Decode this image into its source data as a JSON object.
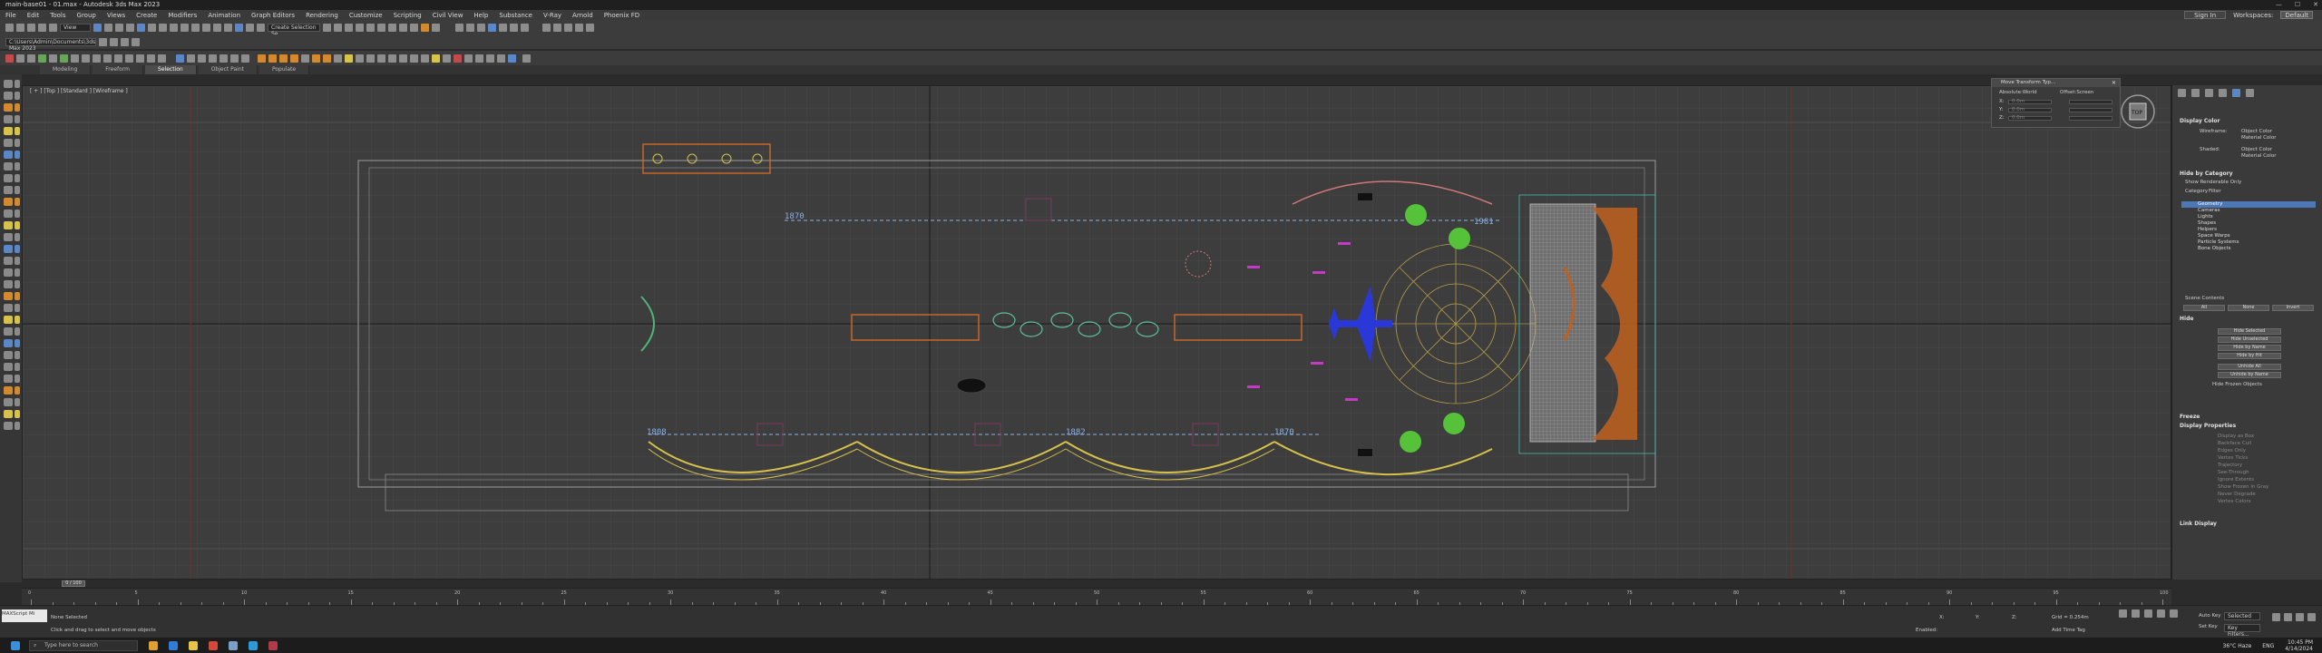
{
  "app": {
    "window_title": "main-base01 - 01.max - Autodesk 3ds Max 2023",
    "win_buttons": [
      "—",
      "☐",
      "✕"
    ]
  },
  "menu": {
    "items": [
      "File",
      "Edit",
      "Tools",
      "Group",
      "Views",
      "Create",
      "Modifiers",
      "Animation",
      "Graph Editors",
      "Rendering",
      "Customize",
      "Scripting",
      "Civil View",
      "Help",
      "Substance",
      "V-Ray",
      "Arnold",
      "Phoenix FD"
    ],
    "sign_in": "Sign In",
    "workspaces_label": "Workspaces:",
    "workspaces_value": "Default"
  },
  "toolbar": {
    "selection_filter": "View",
    "selection_set": "Create Selection Se"
  },
  "project_path": "C:\\Users\\Admin\\Documents\\3ds Max 2023",
  "ribbon": {
    "tabs": [
      "Modeling",
      "Freeform",
      "Selection",
      "Object Paint",
      "Populate"
    ],
    "active": "Selection"
  },
  "viewport": {
    "label": "[ + ] [Top ] [Standard ] [Wireframe ]",
    "dimension_labels": [
      "1870",
      "1981",
      "1808",
      "1882",
      "1870"
    ],
    "view_cube_label": "TOP"
  },
  "move_transform": {
    "title": "Move Transform Typ...",
    "absolute": "Absolute:World",
    "offset": "Offset:Screen",
    "axes": [
      "X:",
      "Y:",
      "Z:"
    ],
    "values": [
      "0.0m",
      "0.0m",
      "0.0m"
    ]
  },
  "command_panel": {
    "display_color": "Display Color",
    "wireframe_label": "Wireframe:",
    "shaded_label": "Shaded:",
    "object_color": "Object Color",
    "material_color": "Material Color",
    "hide_by_category": "Hide by Category",
    "show_renderable_only": "Show Renderable Only",
    "category_tab": "Category",
    "filter_tab": "Filter",
    "categories": [
      "Geometry",
      "Cameras",
      "Lights",
      "Shapes",
      "Helpers",
      "Space Warps",
      "Particle Systems",
      "Bone Objects"
    ],
    "scene_contents": "Scene Contents",
    "scene_buttons": [
      "All",
      "None",
      "Invert"
    ],
    "hide": "Hide",
    "hide_buttons": [
      "Hide Selected",
      "Hide Unselected",
      "Hide by Name",
      "Hide by Hit",
      "Unhide All",
      "Unhide by Name"
    ],
    "hide_frozen": "Hide Frozen Objects",
    "freeze": "Freeze",
    "display_properties": "Display Properties",
    "display_props": [
      "Display as Box",
      "Backface Cull",
      "Edges Only",
      "Vertex Ticks",
      "Trajectory",
      "See-Through",
      "Ignore Extents",
      "Show Frozen in Gray",
      "Never Degrade",
      "Vertex Colors"
    ],
    "link_display": "Link Display"
  },
  "timeline": {
    "slider": "0 / 100",
    "ticks": [
      "0",
      "5",
      "10",
      "15",
      "20",
      "25",
      "30",
      "35",
      "40",
      "45",
      "50",
      "55",
      "60",
      "65",
      "70",
      "75",
      "80",
      "85",
      "90",
      "95",
      "100"
    ]
  },
  "status": {
    "selected": "None Selected",
    "prompt": "Click and drag to select and move objects",
    "maxscript": "MAXScript Mi",
    "grid": "Grid = 0.254m",
    "add_time_tag": "Add Time Tag",
    "auto_key": "Auto Key",
    "set_key": "Set Key",
    "selected_dd": "Selected",
    "key_filters": "Key Filters...",
    "enabled": "Enabled:",
    "x": "X:",
    "y": "Y:",
    "z": "Z:"
  },
  "taskbar": {
    "search": "Type here to search",
    "weather": "36°C Haze",
    "lang": "ENG",
    "time": "10:45 PM",
    "date": "4/14/2024"
  },
  "colors": {
    "accent": "#4c78b8",
    "wire_orange": "#c7672b",
    "wire_yellow": "#d6c24a",
    "green": "#4fb33a",
    "blue": "#2a38d8",
    "magenta": "#c43ac4"
  }
}
